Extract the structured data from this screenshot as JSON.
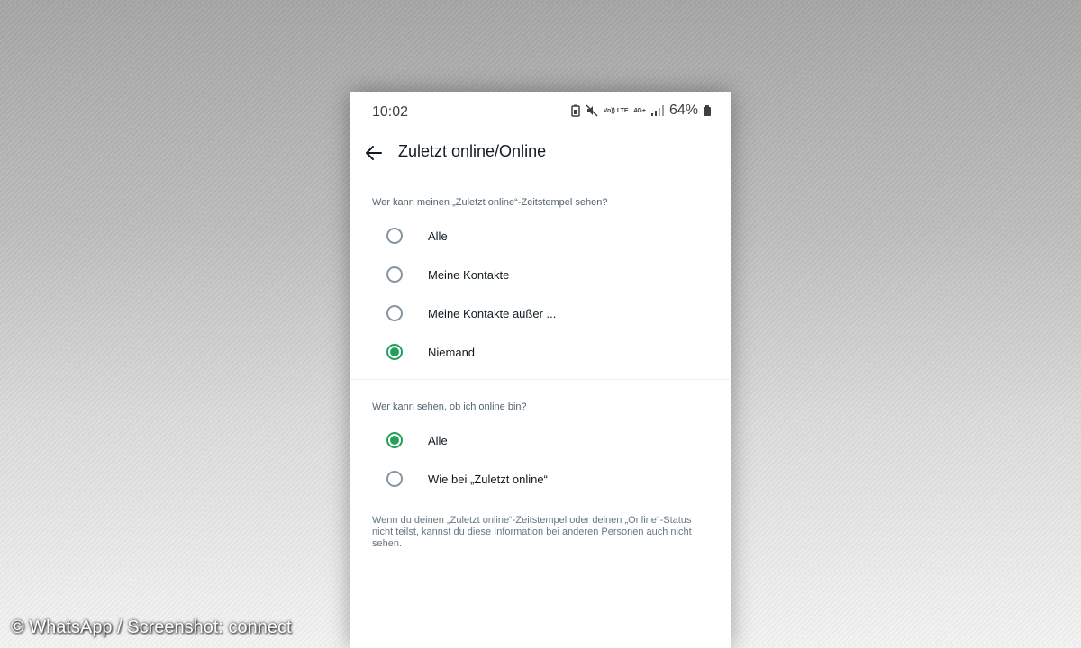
{
  "status_bar": {
    "time": "10:02",
    "net_top": "Vo)) LTE",
    "net_type": "4G+",
    "battery": "64%"
  },
  "app_bar": {
    "title": "Zuletzt online/Online",
    "back_icon": "arrow-left-icon"
  },
  "last_seen": {
    "label": "Wer kann meinen „Zuletzt online“-Zeitstempel sehen?",
    "options": [
      {
        "label": "Alle",
        "selected": false
      },
      {
        "label": "Meine Kontakte",
        "selected": false
      },
      {
        "label": "Meine Kontakte außer ...",
        "selected": false
      },
      {
        "label": "Niemand",
        "selected": true
      }
    ]
  },
  "online": {
    "label": "Wer kann sehen, ob ich online bin?",
    "options": [
      {
        "label": "Alle",
        "selected": true
      },
      {
        "label": "Wie bei „Zuletzt online“",
        "selected": false
      }
    ]
  },
  "footnote": "Wenn du deinen „Zuletzt online“-Zeitstempel oder deinen „Online“-Status nicht teilst, kannst du diese Information bei anderen Personen auch nicht sehen.",
  "watermark": "© WhatsApp / Screenshot: connect",
  "colors": {
    "accent": "#25a05a",
    "radio_off": "#8696a0",
    "text": "#111b21",
    "secondary": "#54656f"
  }
}
